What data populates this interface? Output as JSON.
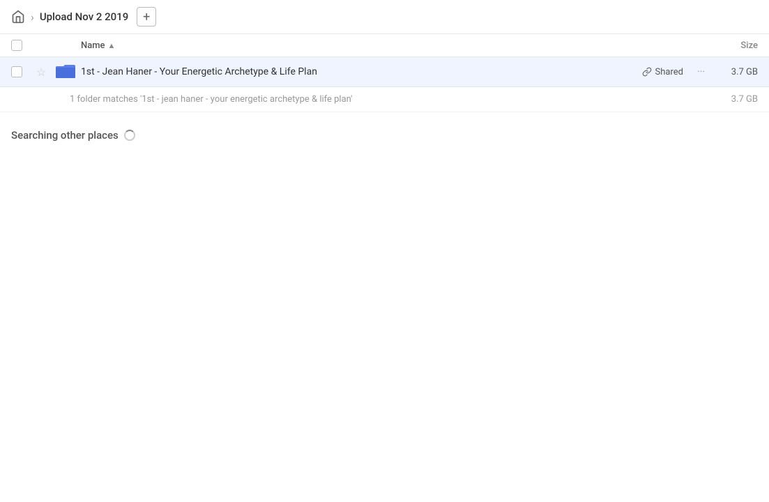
{
  "header": {
    "home_icon": "🏠",
    "breadcrumb_separator": "›",
    "title": "Upload Nov 2 2019",
    "add_button_label": "+"
  },
  "columns": {
    "name_label": "Name",
    "sort_arrow": "▲",
    "size_label": "Size"
  },
  "file_row": {
    "folder_name": "1st - Jean Haner - Your Energetic Archetype & Life Plan",
    "shared_label": "Shared",
    "size": "3.7 GB",
    "more_icon": "···"
  },
  "summary": {
    "text": "1 folder matches '1st - jean haner - your energetic archetype & life plan'",
    "size": "3.7 GB"
  },
  "searching": {
    "label": "Searching other places"
  }
}
